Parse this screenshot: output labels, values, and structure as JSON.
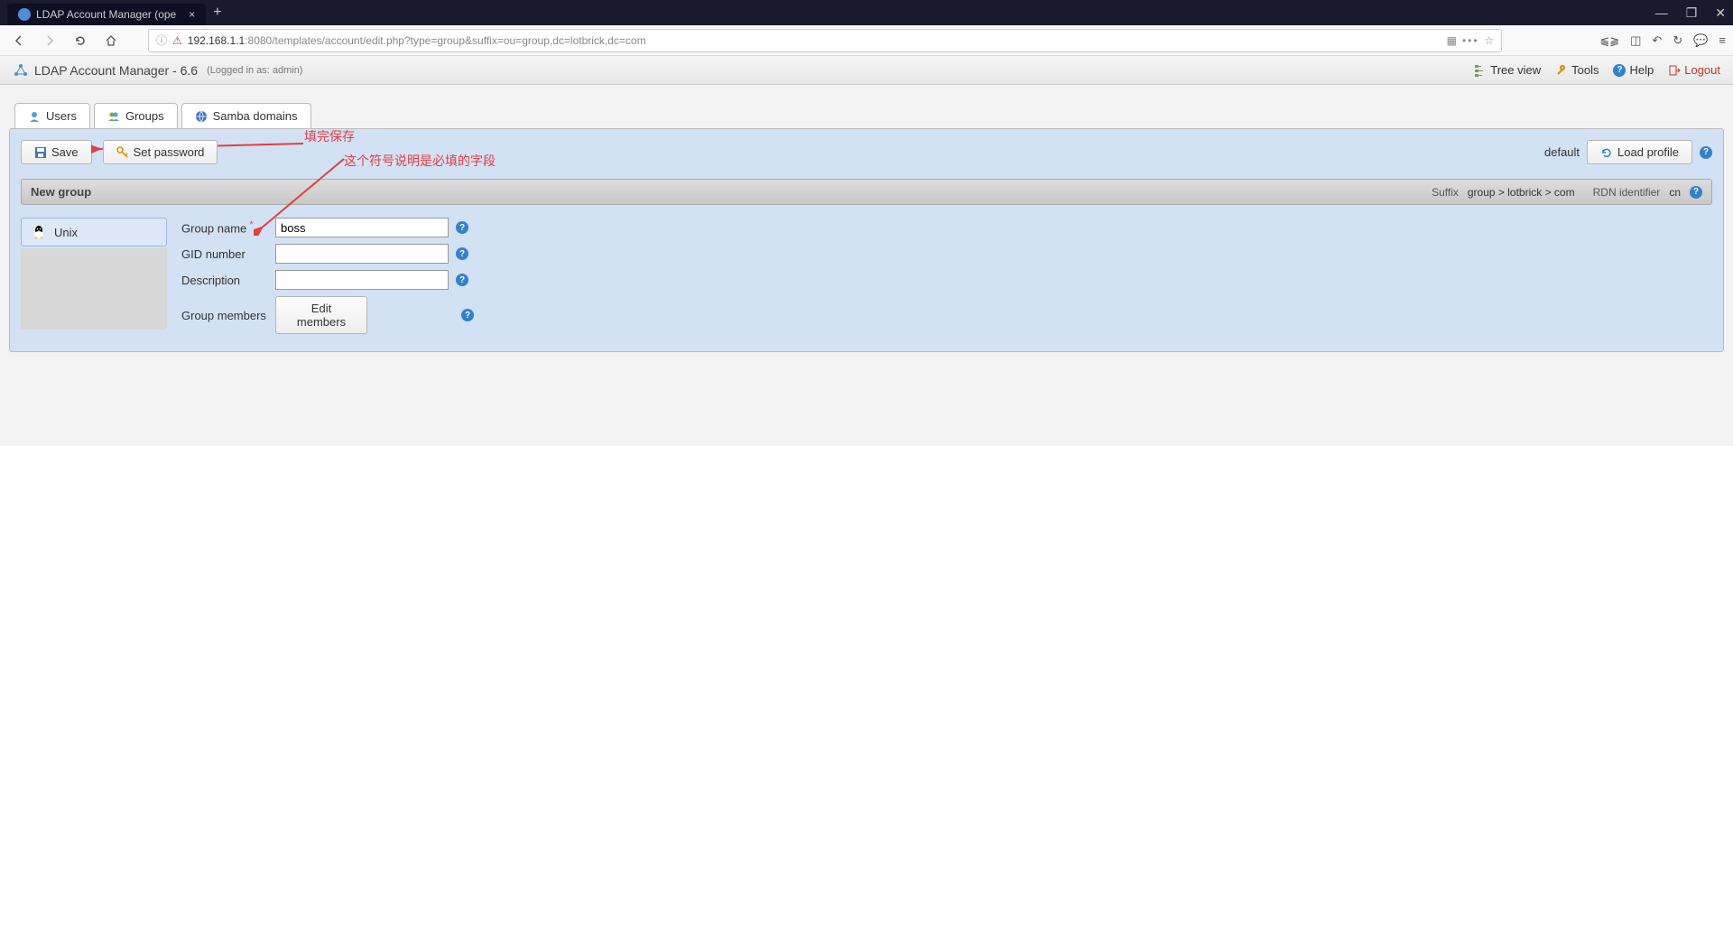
{
  "browser": {
    "tab_title": "LDAP Account Manager (ope",
    "url_host": "192.168.1.1",
    "url_path": ":8080/templates/account/edit.php?type=group&suffix=ou=group,dc=lotbrick,dc=com"
  },
  "app": {
    "title": "LDAP Account Manager - 6.6",
    "login_info": "(Logged in as: admin)",
    "links": {
      "tree_view": "Tree view",
      "tools": "Tools",
      "help": "Help",
      "logout": "Logout"
    }
  },
  "tabs": {
    "users": "Users",
    "groups": "Groups",
    "samba": "Samba domains"
  },
  "actions": {
    "save": "Save",
    "set_password": "Set password",
    "default_label": "default",
    "load_profile": "Load profile"
  },
  "section": {
    "title": "New group",
    "suffix_label": "Suffix",
    "suffix_value": "group > lotbrick > com",
    "rdn_label": "RDN identifier",
    "rdn_value": "cn"
  },
  "sidebar": {
    "items": [
      {
        "label": "Unix"
      }
    ]
  },
  "fields": {
    "group_name": {
      "label": "Group name",
      "value": "boss",
      "required": true
    },
    "gid_number": {
      "label": "GID number",
      "value": ""
    },
    "description": {
      "label": "Description",
      "value": ""
    },
    "group_members": {
      "label": "Group members",
      "edit_label": "Edit members"
    }
  },
  "annotations": {
    "save_note": "填完保存",
    "required_note": "这个符号说明是必填的字段"
  }
}
